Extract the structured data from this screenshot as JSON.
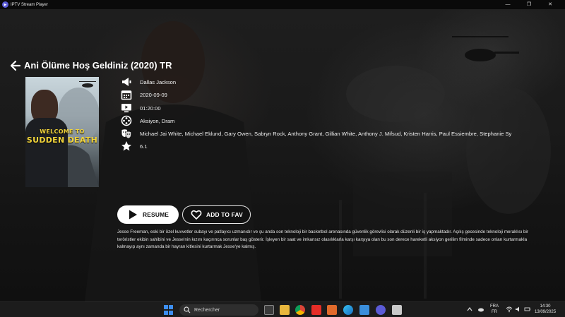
{
  "window": {
    "title": "IPTV Stream Player",
    "controls": {
      "minimize": "—",
      "maximize": "❐",
      "close": "✕"
    }
  },
  "movie": {
    "title": "Ani Ölüme Hoş Geldiniz (2020) TR",
    "poster_line1": "WELCOME TO",
    "poster_line2": "SUDDEN DEATH",
    "director": "Dallas Jackson",
    "release_date": "2020-09-09",
    "duration": "01:20:00",
    "genre": "Aksiyon, Dram",
    "cast": "Michael Jai White, Michael Eklund, Gary Owen, Sabryn Rock, Anthony Grant, Gillian White, Anthony J. Mifsud, Kristen Harris, Paul Essiembre, Stephanie Sy",
    "rating": "6.1",
    "description": "Jesse Freeman, eski bir özel kuvvetler subayı ve patlayıcı uzmanıdır ve şu anda son teknoloji bir basketbol arenasında güvenlik görevlisi olarak düzenli bir iş yapmaktadır. Açılış gecesinde teknoloji meraklısı bir teröristler ekibin sahibini ve Jesse'nin kızını kaçırınca sorunlar baş gösterir. İşleyen bir saat ve imkansız olasılıklarla karşı karşıya olan bu son derece hareketli aksiyon gerilim filminde sadece onları kurtarmakla kalmayıp aynı zamanda bir hayran kitlesini kurtarmak Jesse'ye kalmış."
  },
  "actions": {
    "resume_label": "RESUME",
    "fav_label": "ADD TO FAV"
  },
  "taskbar": {
    "search_placeholder": "Rechercher",
    "lang_top": "FRA",
    "lang_bottom": "FR",
    "time": "14:30",
    "date": "13/09/2025"
  },
  "colors": {
    "accent": "#5b5bd6",
    "poster_text": "#f2d43a",
    "resume_bg": "#ffffff"
  }
}
